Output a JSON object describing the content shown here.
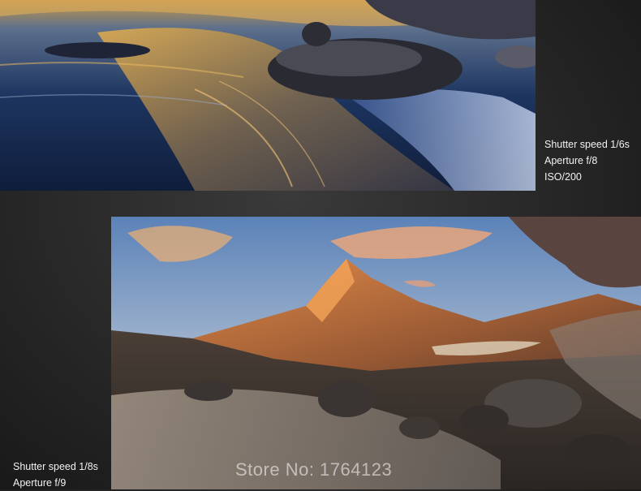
{
  "photos": [
    {
      "id": "beach-rocks",
      "caption": {
        "shutter": "Shutter speed  1/6s",
        "aperture": "Aperture f/8",
        "iso": "ISO/200"
      }
    },
    {
      "id": "mountain-river",
      "caption": {
        "shutter": "Shutter speed  1/8s",
        "aperture": "Aperture f/9"
      }
    }
  ],
  "watermark": "Store No: 1764123"
}
